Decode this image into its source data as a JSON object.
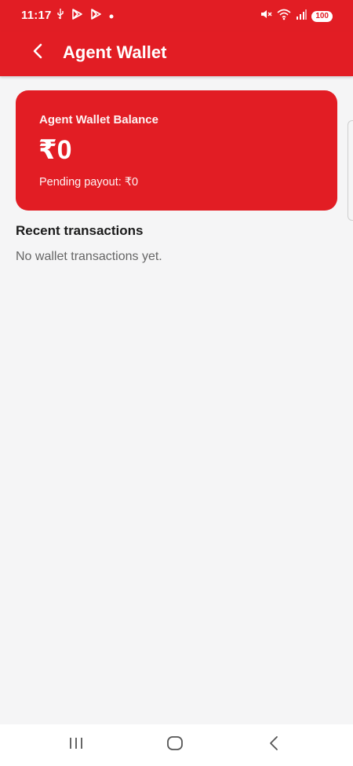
{
  "status_bar": {
    "time": "11:17",
    "battery": "100",
    "icons_left": [
      "usb-icon",
      "play-icon",
      "play-icon",
      "dot-icon"
    ],
    "icons_right": [
      "mute-icon",
      "wifi-icon",
      "signal-icon",
      "battery-icon"
    ]
  },
  "header": {
    "title": "Agent Wallet",
    "back_icon": "back-arrow-icon",
    "color": "#e21d24"
  },
  "wallet_card": {
    "label": "Agent Wallet Balance",
    "balance": "₹0",
    "pending": "Pending payout: ₹0"
  },
  "transactions": {
    "title": "Recent transactions",
    "empty_message": "No wallet transactions yet."
  },
  "nav_bar": {
    "icons": [
      "recent-apps-icon",
      "home-icon",
      "back-icon"
    ]
  }
}
